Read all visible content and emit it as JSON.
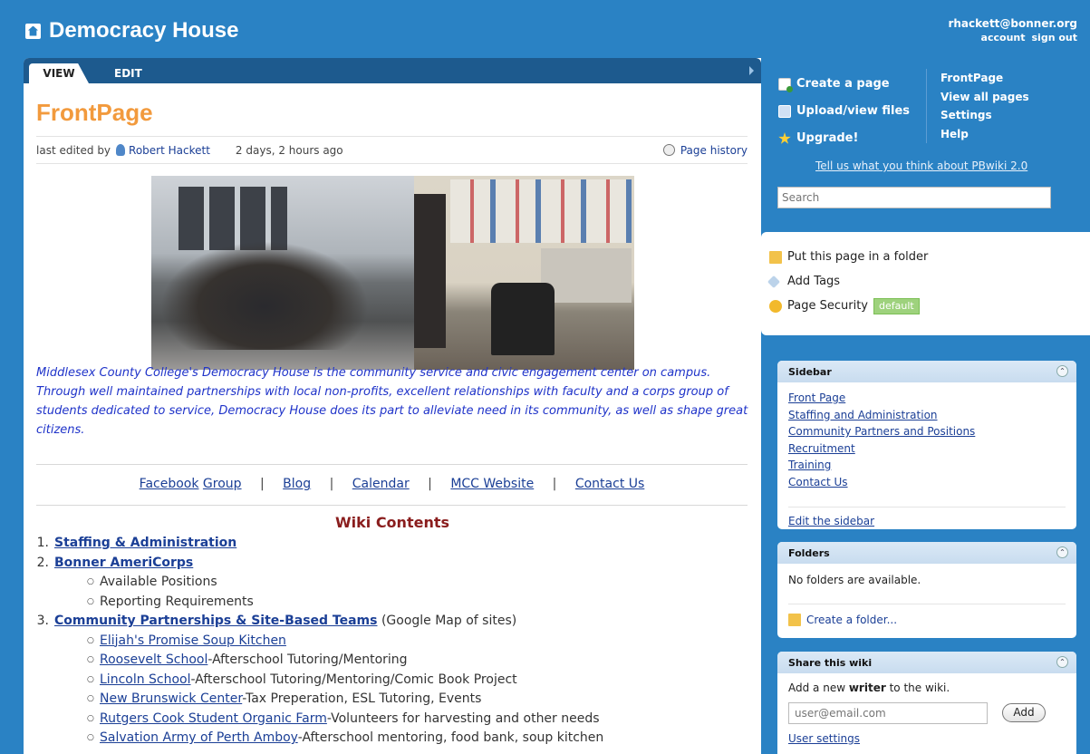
{
  "header": {
    "site_title": "Democracy House",
    "user": "rhackett@bonner.org",
    "account": "account",
    "signout": "sign out"
  },
  "tabs": {
    "view": "VIEW",
    "edit": "EDIT"
  },
  "page": {
    "title": "FrontPage",
    "edited_prefix": "last edited by",
    "author": "Robert Hackett",
    "edited_ago": "2 days, 2 hours ago",
    "history": "Page history"
  },
  "intro": "Middlesex County College's Democracy House is the community service and civic engagement center on campus. Through well maintained partnerships with local non-profits, excellent relationships with faculty and a corps group of students dedicated to service, Democracy House does its part to alleviate need in its community, as well as shape great citizens.",
  "linkbar": {
    "facebook": "Facebook",
    "group": "Group",
    "blog": "Blog",
    "calendar": "Calendar",
    "mcc": "MCC Website",
    "contact": "Contact Us",
    "sep": "|"
  },
  "contents": {
    "title": "Wiki Contents",
    "s1": {
      "num": "1.",
      "label": "Staffing & Administration"
    },
    "s2": {
      "num": "2.",
      "label": "Bonner AmeriCorps",
      "items": [
        "Available Positions",
        "Reporting Requirements"
      ]
    },
    "s3": {
      "num": "3.",
      "label": "Community Partnerships & Site-Based Teams",
      "suffix": "(Google Map of sites)",
      "items": [
        {
          "link": "Elijah's Promise Soup Kitchen",
          "desc": ""
        },
        {
          "link": "Roosevelt School",
          "desc": "-Afterschool Tutoring/Mentoring"
        },
        {
          "link": "Lincoln School",
          "desc": "-Afterschool Tutoring/Mentoring/Comic Book Project"
        },
        {
          "link": "New Brunswick Center",
          "desc": "-Tax Preperation, ESL Tutoring, Events"
        },
        {
          "link": "Rutgers Cook Student Organic Farm",
          "desc": "-Volunteers for harvesting and other needs"
        },
        {
          "link": "Salvation Army of Perth Amboy",
          "desc": "-Afterschool mentoring, food bank, soup kitchen"
        }
      ]
    }
  },
  "actions": {
    "create": "Create a page",
    "upload": "Upload/view files",
    "upgrade": "Upgrade!"
  },
  "quick_links": [
    "FrontPage",
    "View all pages",
    "Settings",
    "Help"
  ],
  "feedback": "Tell us what you think about PBwiki 2.0",
  "search": {
    "placeholder": "Search"
  },
  "page_tools": {
    "folder": "Put this page in a folder",
    "tags": "Add Tags",
    "security": "Page Security",
    "security_badge": "default"
  },
  "sidebar_widget": {
    "title": "Sidebar",
    "links": [
      "Front Page",
      "Staffing and Administration",
      "Community Partners and Positions",
      "Recruitment",
      "Training",
      "Contact Us"
    ],
    "edit": "Edit the sidebar"
  },
  "folders_widget": {
    "title": "Folders",
    "empty": "No folders are available.",
    "create": "Create a folder..."
  },
  "share_widget": {
    "title": "Share this wiki",
    "text_pre": "Add a new ",
    "text_bold": "writer",
    "text_post": " to the wiki.",
    "email_placeholder": "user@email.com",
    "add": "Add",
    "settings": "User settings"
  },
  "icons": {
    "toggle": "⌃"
  }
}
